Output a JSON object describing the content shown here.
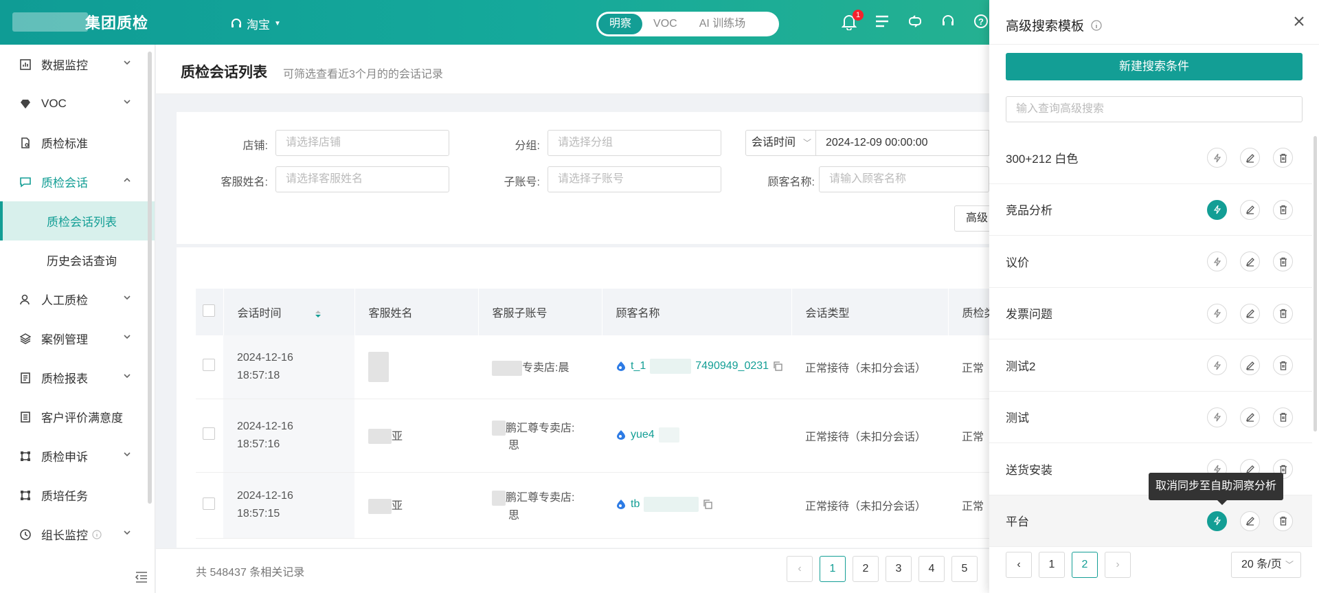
{
  "brand": {
    "name": "集团质检",
    "accent": "#139e95"
  },
  "topbar": {
    "platform": "淘宝",
    "segments": [
      {
        "label": "明察",
        "active": true
      },
      {
        "label": "VOC",
        "active": false
      },
      {
        "label": "AI 训练场",
        "active": false
      }
    ],
    "notification_count": "1"
  },
  "sidebar": {
    "items": [
      {
        "label": "数据监控",
        "icon": "chart-icon",
        "expandable": true
      },
      {
        "label": "VOC",
        "icon": "diamond-icon",
        "expandable": true
      },
      {
        "label": "质检标准",
        "icon": "document-icon",
        "expandable": false
      },
      {
        "label": "质检会话",
        "icon": "chat-icon",
        "expandable": true,
        "open": true
      },
      {
        "label": "质检会话列表",
        "sub": true,
        "active": true
      },
      {
        "label": "历史会话查询",
        "sub": true
      },
      {
        "label": "人工质检",
        "icon": "user-icon",
        "expandable": true
      },
      {
        "label": "案例管理",
        "icon": "layers-icon",
        "expandable": true
      },
      {
        "label": "质检报表",
        "icon": "report-icon",
        "expandable": true
      },
      {
        "label": "客户评价满意度",
        "icon": "rating-icon",
        "expandable": false
      },
      {
        "label": "质检申诉",
        "icon": "appeal-icon",
        "expandable": true
      },
      {
        "label": "质培任务",
        "icon": "task-icon",
        "expandable": false
      },
      {
        "label": "组长监控",
        "icon": "clock-icon",
        "expandable": true
      }
    ]
  },
  "page": {
    "title": "质检会话列表",
    "subtitle": "可筛选查看近3个月的的会话记录"
  },
  "filters": {
    "shop_label": "店铺:",
    "shop_placeholder": "请选择店铺",
    "group_label": "分组:",
    "group_placeholder": "请选择分组",
    "time_select": "会话时间",
    "time_value": "2024-12-09 00:00:00",
    "agent_label": "客服姓名:",
    "agent_placeholder": "请选择客服姓名",
    "subaccount_label": "子账号:",
    "subaccount_placeholder": "请选择子账号",
    "customer_label": "顾客名称:",
    "customer_placeholder": "请输入顾客名称",
    "advanced_button": "高级"
  },
  "table": {
    "columns": [
      "会话时间",
      "客服姓名",
      "客服子账号",
      "顾客名称",
      "会话类型",
      "质检类"
    ],
    "rows": [
      {
        "date": "2024-12-16",
        "time": "18:57:18",
        "agent": "",
        "subaccount": "专卖店:晨",
        "subaccount2": "",
        "customer": "t_1",
        "customer2": "7490949_0231",
        "type": "正常接待（未扣分会话）",
        "qc": "正常"
      },
      {
        "date": "2024-12-16",
        "time": "18:57:16",
        "agent": "亚",
        "subaccount": "鹏汇尊专卖店:",
        "subaccount2": "思",
        "customer": "yue4",
        "customer2": "",
        "type": "正常接待（未扣分会话）",
        "qc": "正常"
      },
      {
        "date": "2024-12-16",
        "time": "18:57:15",
        "agent": "亚",
        "subaccount": "鹏汇尊专卖店:",
        "subaccount2": "思",
        "customer": "tb",
        "customer2": "",
        "type": "正常接待（未扣分会话）",
        "qc": "正常"
      }
    ]
  },
  "footer": {
    "total": "共 548437 条相关记录",
    "pages": [
      "1",
      "2",
      "3",
      "4",
      "5"
    ],
    "current_page": "1"
  },
  "panel": {
    "title": "高级搜索模板",
    "new_button": "新建搜索条件",
    "search_placeholder": "输入查询高级搜索",
    "templates": [
      {
        "name": "300+212 白色",
        "synced": false
      },
      {
        "name": "竞品分析",
        "synced": true
      },
      {
        "name": "议价",
        "synced": false
      },
      {
        "name": "发票问题",
        "synced": false
      },
      {
        "name": "测试2",
        "synced": false
      },
      {
        "name": "测试",
        "synced": false
      },
      {
        "name": "送货安装",
        "synced": false
      },
      {
        "name": "平台",
        "synced": true
      }
    ],
    "tooltip": "取消同步至自助洞察分析",
    "pages": [
      "1",
      "2"
    ],
    "current_page": "2",
    "page_size": "20 条/页"
  }
}
